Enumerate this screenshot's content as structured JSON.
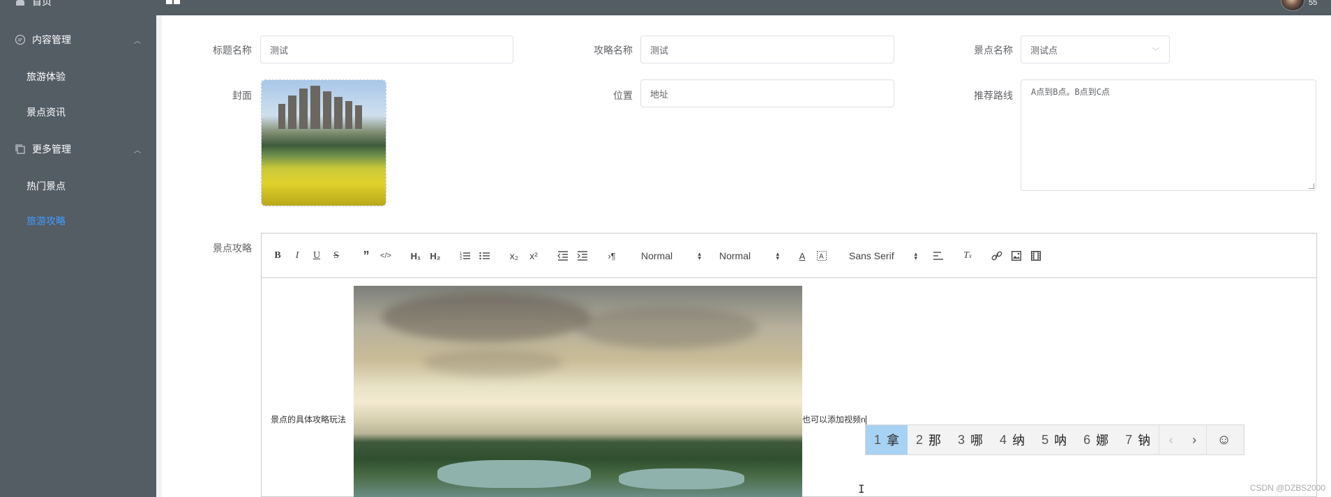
{
  "sidebar": {
    "top_item": "首页",
    "groups": [
      {
        "label": "内容管理",
        "items": [
          "旅游体验",
          "景点资讯"
        ]
      },
      {
        "label": "更多管理",
        "items": [
          "热门景点",
          "旅游攻略"
        ]
      }
    ],
    "active_item": "旅游攻略",
    "colors": {
      "background": "#545c64",
      "active": "#409eff",
      "text": "#ffffff"
    }
  },
  "header": {
    "username": "55"
  },
  "form": {
    "title_label": "标题名称",
    "title_value": "测试",
    "guide_label": "攻略名称",
    "guide_value": "测试",
    "spot_label": "景点名称",
    "spot_value": "测试点",
    "cover_label": "封面",
    "location_label": "位置",
    "location_value": "地址",
    "route_label": "推荐路线",
    "route_value": "A点到B点。B点到C点",
    "content_label": "景点攻略"
  },
  "editor": {
    "toolbar": {
      "header_select": "Normal",
      "size_select": "Normal",
      "font_select": "Sans Serif"
    },
    "text_before_image": "景点的具体攻略玩法",
    "text_after_image": "也可以添加视频n"
  },
  "ime": {
    "candidates": [
      {
        "num": "1",
        "char": "拿"
      },
      {
        "num": "2",
        "char": "那"
      },
      {
        "num": "3",
        "char": "哪"
      },
      {
        "num": "4",
        "char": "纳"
      },
      {
        "num": "5",
        "char": "呐"
      },
      {
        "num": "6",
        "char": "娜"
      },
      {
        "num": "7",
        "char": "钠"
      }
    ],
    "prev": "‹",
    "next": "›",
    "emoji": "☺"
  },
  "watermark": "CSDN @DZBS2000"
}
